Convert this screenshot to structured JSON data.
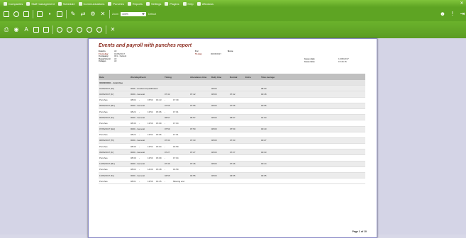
{
  "menu": [
    {
      "icon": "companies-icon",
      "label": "Companies"
    },
    {
      "icon": "staff-icon",
      "label": "Staff management"
    },
    {
      "icon": "schedule-icon",
      "label": "Schedule"
    },
    {
      "icon": "communications-icon",
      "label": "Communications"
    },
    {
      "icon": "punches-icon",
      "label": "Punches"
    },
    {
      "icon": "reports-icon",
      "label": "Reports"
    },
    {
      "icon": "settings-icon",
      "label": "Settings"
    },
    {
      "icon": "plugins-icon",
      "label": "Plugins"
    },
    {
      "icon": "help-icon",
      "label": "Help"
    },
    {
      "icon": "windows-icon",
      "label": "Windows"
    }
  ],
  "toolbar": {
    "zoom_label": "Zoom",
    "zoom_value": "100%",
    "default_label": "Default"
  },
  "report": {
    "title": "Events and payroll with punches report",
    "events_k": "Events",
    "events_v": "All",
    "from_k": "From day",
    "from_v": "01/06/2017",
    "company_k": "Company",
    "company_v": "001 - Default",
    "department_k": "Department",
    "department_v": "All",
    "cat_k": "Catego.",
    "cat_v": "All",
    "for_k": "For",
    "for_v": "",
    "to_k": "To day",
    "to_v": "30/06/2017",
    "none_k": "None",
    "issue_date_k": "Issue date",
    "issue_date_v": "11/06/2017",
    "issue_time_k": "Issue time",
    "issue_time_v": "15:46:15",
    "headers": [
      "Date",
      "Workday/Event",
      "Timing",
      "Attendance time",
      "Daily time",
      "Normal",
      "Extra",
      "Time average"
    ],
    "employee": "0000000001 - John Doe",
    "page_label": "Page 1 of 10"
  },
  "rows": [
    {
      "type": "data",
      "date": "01/06/2017 [Th]",
      "event": "0006 - Academic/qualification",
      "timing": "",
      "att": "",
      "daily": "08:00",
      "normal": "",
      "extra": "",
      "avg": "08:00"
    },
    {
      "type": "data",
      "date": "02/06/2017 [Fr]",
      "event": "0000 - General",
      "timing": "07:42",
      "att": "07:42",
      "daily": "08:00",
      "normal": "07:42",
      "extra": "",
      "avg": "00:18"
    },
    {
      "type": "punch",
      "date": "Punches",
      "p": [
        "08:04",
        "-",
        "15:53",
        "16:13",
        "-",
        "17:39"
      ]
    },
    {
      "type": "data",
      "date": "05/06/2017 [Mo]",
      "event": "0000 - General",
      "timing": "07:55",
      "att": "07:55",
      "daily": "08:00",
      "normal": "07:55",
      "extra": "",
      "avg": "00:05"
    },
    {
      "type": "punch",
      "date": "Punches",
      "p": [
        "08:22",
        "-",
        "13:54",
        "15:06",
        "-",
        "17:01"
      ]
    },
    {
      "type": "data",
      "date": "06/06/2017 [Tu]",
      "event": "0000 - General",
      "timing": "06:57",
      "att": "06:57",
      "daily": "08:00",
      "normal": "06:57",
      "extra": "",
      "avg": "01:03"
    },
    {
      "type": "punch",
      "date": "Punches",
      "p": [
        "08:36",
        "-",
        "13:50",
        "15:09",
        "-",
        "17:04"
      ]
    },
    {
      "type": "data",
      "date": "07/06/2017 [We]",
      "event": "0000 - General",
      "timing": "07:50",
      "att": "07:50",
      "daily": "08:00",
      "normal": "07:50",
      "extra": "",
      "avg": "00:10"
    },
    {
      "type": "punch",
      "date": "Punches",
      "p": [
        "08:22",
        "-",
        "13:54",
        "15:06",
        "-",
        "17:01"
      ]
    },
    {
      "type": "data",
      "date": "08/06/2017 [Th]",
      "event": "0000 - General",
      "timing": "07:33",
      "att": "07:33",
      "daily": "08:00",
      "normal": "07:33",
      "extra": "",
      "avg": "00:27"
    },
    {
      "type": "punch",
      "date": "Punches",
      "p": [
        "08:30",
        "-",
        "13:54",
        "15:04",
        "-",
        "16:59"
      ]
    },
    {
      "type": "data",
      "date": "09/06/2017 [Fr]",
      "event": "0000 - General",
      "timing": "07:27",
      "att": "07:27",
      "daily": "08:00",
      "normal": "07:27",
      "extra": "",
      "avg": "00:33"
    },
    {
      "type": "punch",
      "date": "Punches",
      "p": [
        "08:39",
        "-",
        "13:53",
        "15:09",
        "-",
        "17:04"
      ]
    },
    {
      "type": "data",
      "date": "12/06/2017 [Mo]",
      "event": "0000 - General",
      "timing": "07:46",
      "att": "07:46",
      "daily": "08:00",
      "normal": "07:46",
      "extra": "",
      "avg": "00:14"
    },
    {
      "type": "punch",
      "date": "Punches",
      "p": [
        "08:02",
        "-",
        "14:00",
        "15:18",
        "-",
        "16:59"
      ]
    },
    {
      "type": "data",
      "date": "13/06/2017 [Tu]",
      "event": "0000 - General",
      "timing": "04:55",
      "att": "04:55",
      "daily": "08:00",
      "normal": "04:55",
      "extra": "",
      "avg": "03:05"
    },
    {
      "type": "punch",
      "date": "Punches",
      "p": [
        "08:01",
        "-",
        "13:56",
        "16:15",
        "-",
        "Missing end"
      ]
    }
  ]
}
